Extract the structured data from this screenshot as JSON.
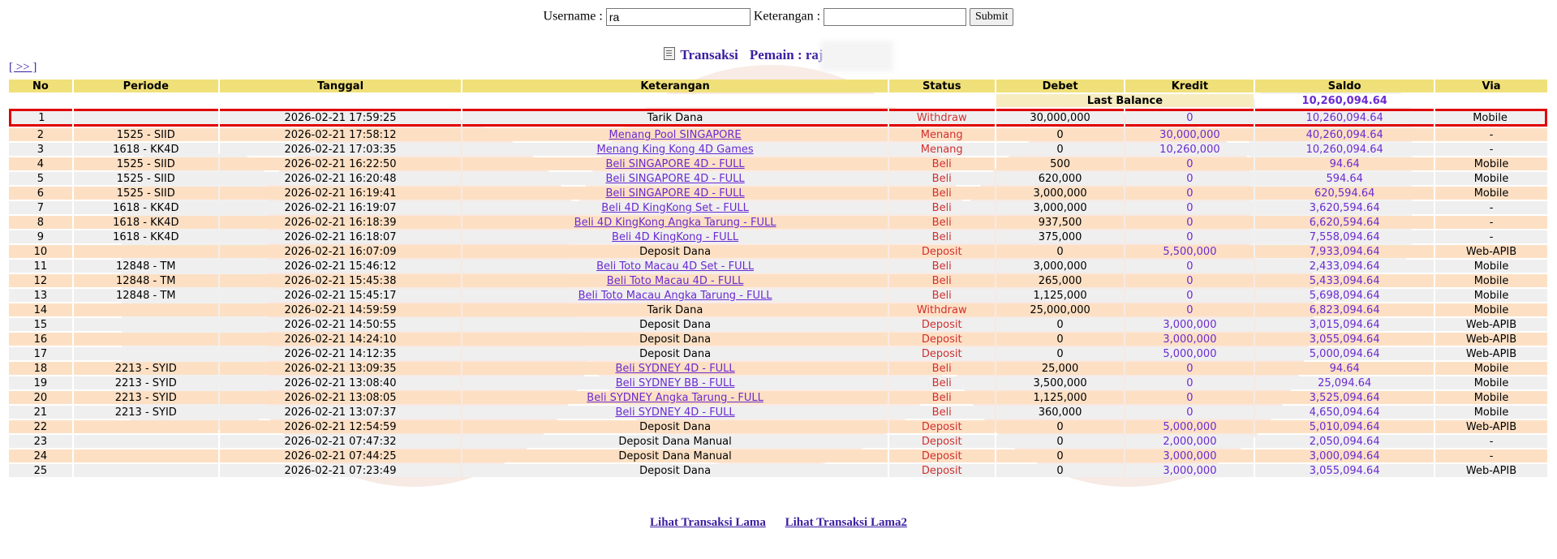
{
  "form": {
    "username_label": "Username :",
    "username_value": "ra",
    "keterangan_label": "Keterangan :",
    "keterangan_value": "",
    "submit_label": "Submit"
  },
  "heading": {
    "title": "Transaksi",
    "pemain_label": "Pemain : raj"
  },
  "nav_link": "[ >> ]",
  "table": {
    "headers": [
      "No",
      "Periode",
      "Tanggal",
      "Keterangan",
      "Status",
      "Debet",
      "Kredit",
      "Saldo",
      "Via"
    ],
    "last_balance_label": "Last Balance",
    "last_balance_value": "10,260,094.64",
    "rows": [
      {
        "no": "1",
        "periode": "",
        "tanggal": "2026-02-21 17:59:25",
        "ket": "Tarik Dana",
        "link": false,
        "status": "Withdraw",
        "debet": "30,000,000",
        "kredit": "0",
        "saldo": "10,260,094.64",
        "via": "Mobile"
      },
      {
        "no": "2",
        "periode": "1525 - SIID",
        "tanggal": "2026-02-21 17:58:12",
        "ket": "Menang Pool SINGAPORE",
        "link": true,
        "status": "Menang",
        "debet": "0",
        "kredit": "30,000,000",
        "saldo": "40,260,094.64",
        "via": "-"
      },
      {
        "no": "3",
        "periode": "1618 - KK4D",
        "tanggal": "2026-02-21 17:03:35",
        "ket": "Menang King Kong 4D Games",
        "link": true,
        "status": "Menang",
        "debet": "0",
        "kredit": "10,260,000",
        "saldo": "10,260,094.64",
        "via": "-"
      },
      {
        "no": "4",
        "periode": "1525 - SIID",
        "tanggal": "2026-02-21 16:22:50",
        "ket": "Beli SINGAPORE 4D - FULL",
        "link": true,
        "status": "Beli",
        "debet": "500",
        "kredit": "0",
        "saldo": "94.64",
        "via": "Mobile"
      },
      {
        "no": "5",
        "periode": "1525 - SIID",
        "tanggal": "2026-02-21 16:20:48",
        "ket": "Beli SINGAPORE 4D - FULL",
        "link": true,
        "status": "Beli",
        "debet": "620,000",
        "kredit": "0",
        "saldo": "594.64",
        "via": "Mobile"
      },
      {
        "no": "6",
        "periode": "1525 - SIID",
        "tanggal": "2026-02-21 16:19:41",
        "ket": "Beli SINGAPORE 4D - FULL",
        "link": true,
        "status": "Beli",
        "debet": "3,000,000",
        "kredit": "0",
        "saldo": "620,594.64",
        "via": "Mobile"
      },
      {
        "no": "7",
        "periode": "1618 - KK4D",
        "tanggal": "2026-02-21 16:19:07",
        "ket": "Beli 4D KingKong Set - FULL",
        "link": true,
        "status": "Beli",
        "debet": "3,000,000",
        "kredit": "0",
        "saldo": "3,620,594.64",
        "via": "-"
      },
      {
        "no": "8",
        "periode": "1618 - KK4D",
        "tanggal": "2026-02-21 16:18:39",
        "ket": "Beli 4D KingKong Angka Tarung - FULL",
        "link": true,
        "status": "Beli",
        "debet": "937,500",
        "kredit": "0",
        "saldo": "6,620,594.64",
        "via": "-"
      },
      {
        "no": "9",
        "periode": "1618 - KK4D",
        "tanggal": "2026-02-21 16:18:07",
        "ket": "Beli 4D KingKong - FULL",
        "link": true,
        "status": "Beli",
        "debet": "375,000",
        "kredit": "0",
        "saldo": "7,558,094.64",
        "via": "-"
      },
      {
        "no": "10",
        "periode": "",
        "tanggal": "2026-02-21 16:07:09",
        "ket": "Deposit Dana",
        "link": false,
        "status": "Deposit",
        "debet": "0",
        "kredit": "5,500,000",
        "saldo": "7,933,094.64",
        "via": "Web-APIB"
      },
      {
        "no": "11",
        "periode": "12848 - TM",
        "tanggal": "2026-02-21 15:46:12",
        "ket": "Beli Toto Macau 4D Set - FULL",
        "link": true,
        "status": "Beli",
        "debet": "3,000,000",
        "kredit": "0",
        "saldo": "2,433,094.64",
        "via": "Mobile"
      },
      {
        "no": "12",
        "periode": "12848 - TM",
        "tanggal": "2026-02-21 15:45:38",
        "ket": "Beli Toto Macau 4D - FULL",
        "link": true,
        "status": "Beli",
        "debet": "265,000",
        "kredit": "0",
        "saldo": "5,433,094.64",
        "via": "Mobile"
      },
      {
        "no": "13",
        "periode": "12848 - TM",
        "tanggal": "2026-02-21 15:45:17",
        "ket": "Beli Toto Macau Angka Tarung - FULL",
        "link": true,
        "status": "Beli",
        "debet": "1,125,000",
        "kredit": "0",
        "saldo": "5,698,094.64",
        "via": "Mobile"
      },
      {
        "no": "14",
        "periode": "",
        "tanggal": "2026-02-21 14:59:59",
        "ket": "Tarik Dana",
        "link": false,
        "status": "Withdraw",
        "debet": "25,000,000",
        "kredit": "0",
        "saldo": "6,823,094.64",
        "via": "Mobile"
      },
      {
        "no": "15",
        "periode": "",
        "tanggal": "2026-02-21 14:50:55",
        "ket": "Deposit Dana",
        "link": false,
        "status": "Deposit",
        "debet": "0",
        "kredit": "3,000,000",
        "saldo": "3,015,094.64",
        "via": "Web-APIB"
      },
      {
        "no": "16",
        "periode": "",
        "tanggal": "2026-02-21 14:24:10",
        "ket": "Deposit Dana",
        "link": false,
        "status": "Deposit",
        "debet": "0",
        "kredit": "3,000,000",
        "saldo": "3,055,094.64",
        "via": "Web-APIB"
      },
      {
        "no": "17",
        "periode": "",
        "tanggal": "2026-02-21 14:12:35",
        "ket": "Deposit Dana",
        "link": false,
        "status": "Deposit",
        "debet": "0",
        "kredit": "5,000,000",
        "saldo": "5,000,094.64",
        "via": "Web-APIB"
      },
      {
        "no": "18",
        "periode": "2213 - SYID",
        "tanggal": "2026-02-21 13:09:35",
        "ket": "Beli SYDNEY 4D - FULL",
        "link": true,
        "status": "Beli",
        "debet": "25,000",
        "kredit": "0",
        "saldo": "94.64",
        "via": "Mobile"
      },
      {
        "no": "19",
        "periode": "2213 - SYID",
        "tanggal": "2026-02-21 13:08:40",
        "ket": "Beli SYDNEY BB - FULL",
        "link": true,
        "status": "Beli",
        "debet": "3,500,000",
        "kredit": "0",
        "saldo": "25,094.64",
        "via": "Mobile"
      },
      {
        "no": "20",
        "periode": "2213 - SYID",
        "tanggal": "2026-02-21 13:08:05",
        "ket": "Beli SYDNEY Angka Tarung - FULL",
        "link": true,
        "status": "Beli",
        "debet": "1,125,000",
        "kredit": "0",
        "saldo": "3,525,094.64",
        "via": "Mobile"
      },
      {
        "no": "21",
        "periode": "2213 - SYID",
        "tanggal": "2026-02-21 13:07:37",
        "ket": "Beli SYDNEY 4D - FULL",
        "link": true,
        "status": "Beli",
        "debet": "360,000",
        "kredit": "0",
        "saldo": "4,650,094.64",
        "via": "Mobile"
      },
      {
        "no": "22",
        "periode": "",
        "tanggal": "2026-02-21 12:54:59",
        "ket": "Deposit Dana",
        "link": false,
        "status": "Deposit",
        "debet": "0",
        "kredit": "5,000,000",
        "saldo": "5,010,094.64",
        "via": "Web-APIB"
      },
      {
        "no": "23",
        "periode": "",
        "tanggal": "2026-02-21 07:47:32",
        "ket": "Deposit Dana Manual",
        "link": false,
        "status": "Deposit",
        "debet": "0",
        "kredit": "2,000,000",
        "saldo": "2,050,094.64",
        "via": "-"
      },
      {
        "no": "24",
        "periode": "",
        "tanggal": "2026-02-21 07:44:25",
        "ket": "Deposit Dana Manual",
        "link": false,
        "status": "Deposit",
        "debet": "0",
        "kredit": "3,000,000",
        "saldo": "3,000,094.64",
        "via": "-"
      },
      {
        "no": "25",
        "periode": "",
        "tanggal": "2026-02-21 07:23:49",
        "ket": "Deposit Dana",
        "link": false,
        "status": "Deposit",
        "debet": "0",
        "kredit": "3,000,000",
        "saldo": "3,055,094.64",
        "via": "Web-APIB"
      }
    ]
  },
  "footer": {
    "link1": "Lihat Transaksi Lama",
    "link2": "Lihat Transaksi Lama2"
  },
  "colors": {
    "header_bg": "#f0e07a",
    "row_gray": "#efefef",
    "row_peach": "#fde0c4",
    "status_red": "#d03030",
    "link_purple": "#6a2bd1",
    "highlight_border": "#e00000"
  }
}
